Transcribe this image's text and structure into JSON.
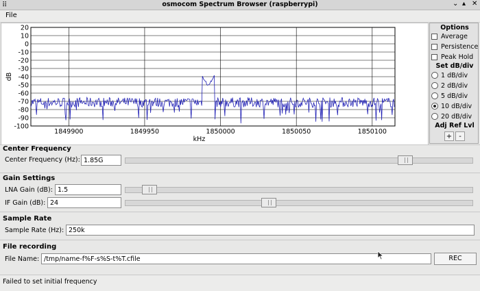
{
  "window": {
    "title": "osmocom Spectrum Browser (raspberrypi)",
    "grip_glyph": "⠿",
    "minimize_glyph": "⌄",
    "maximize_glyph": "▴",
    "close_glyph": "✕"
  },
  "menu": {
    "file": "File"
  },
  "chart_data": {
    "type": "line",
    "ylabel": "dB",
    "xlabel": "kHz",
    "yticks": [
      20,
      10,
      0,
      -10,
      -20,
      -30,
      -40,
      -50,
      -60,
      -70,
      -80,
      -90,
      -100
    ],
    "ylim": [
      -100,
      20
    ],
    "xticks": [
      1849900,
      1849950,
      1850000,
      1850050,
      1850100
    ],
    "xlim": [
      1849875,
      1850115
    ],
    "grid": true,
    "line_color": "#1f1fb4",
    "series": [
      {
        "baseline": -70,
        "noise": 6,
        "peak_x": 1849992,
        "peak_y": -53
      }
    ]
  },
  "options": {
    "header": "Options",
    "checks": [
      {
        "label": "Average",
        "checked": false
      },
      {
        "label": "Persistence",
        "checked": false
      },
      {
        "label": "Peak Hold",
        "checked": false
      }
    ],
    "div_header": "Set dB/div",
    "radios": [
      {
        "label": "1 dB/div",
        "selected": false
      },
      {
        "label": "2 dB/div",
        "selected": false
      },
      {
        "label": "5 dB/div",
        "selected": false
      },
      {
        "label": "10 dB/div",
        "selected": true
      },
      {
        "label": "20 dB/div",
        "selected": false
      }
    ],
    "ref_header": "Adj Ref Lvl",
    "ref_plus": "+",
    "ref_minus": "-"
  },
  "center_frequency": {
    "title": "Center Frequency",
    "label": "Center Frequency (Hz):",
    "value": "1.85G",
    "slider_fraction": 0.82
  },
  "gain": {
    "title": "Gain Settings",
    "lna_label": "LNA Gain (dB):",
    "lna_value": "1.5",
    "lna_fraction": 0.05,
    "if_label": "IF Gain (dB):",
    "if_value": "24",
    "if_fraction": 0.41
  },
  "sample_rate": {
    "title": "Sample Rate",
    "label": "Sample Rate (Hz):",
    "value": "250k"
  },
  "recording": {
    "title": "File recording",
    "label": "File Name:",
    "value": "/tmp/name-f%F-s%S-t%T.cfile",
    "button": "REC"
  },
  "status": {
    "text": "Failed to set initial frequency"
  }
}
